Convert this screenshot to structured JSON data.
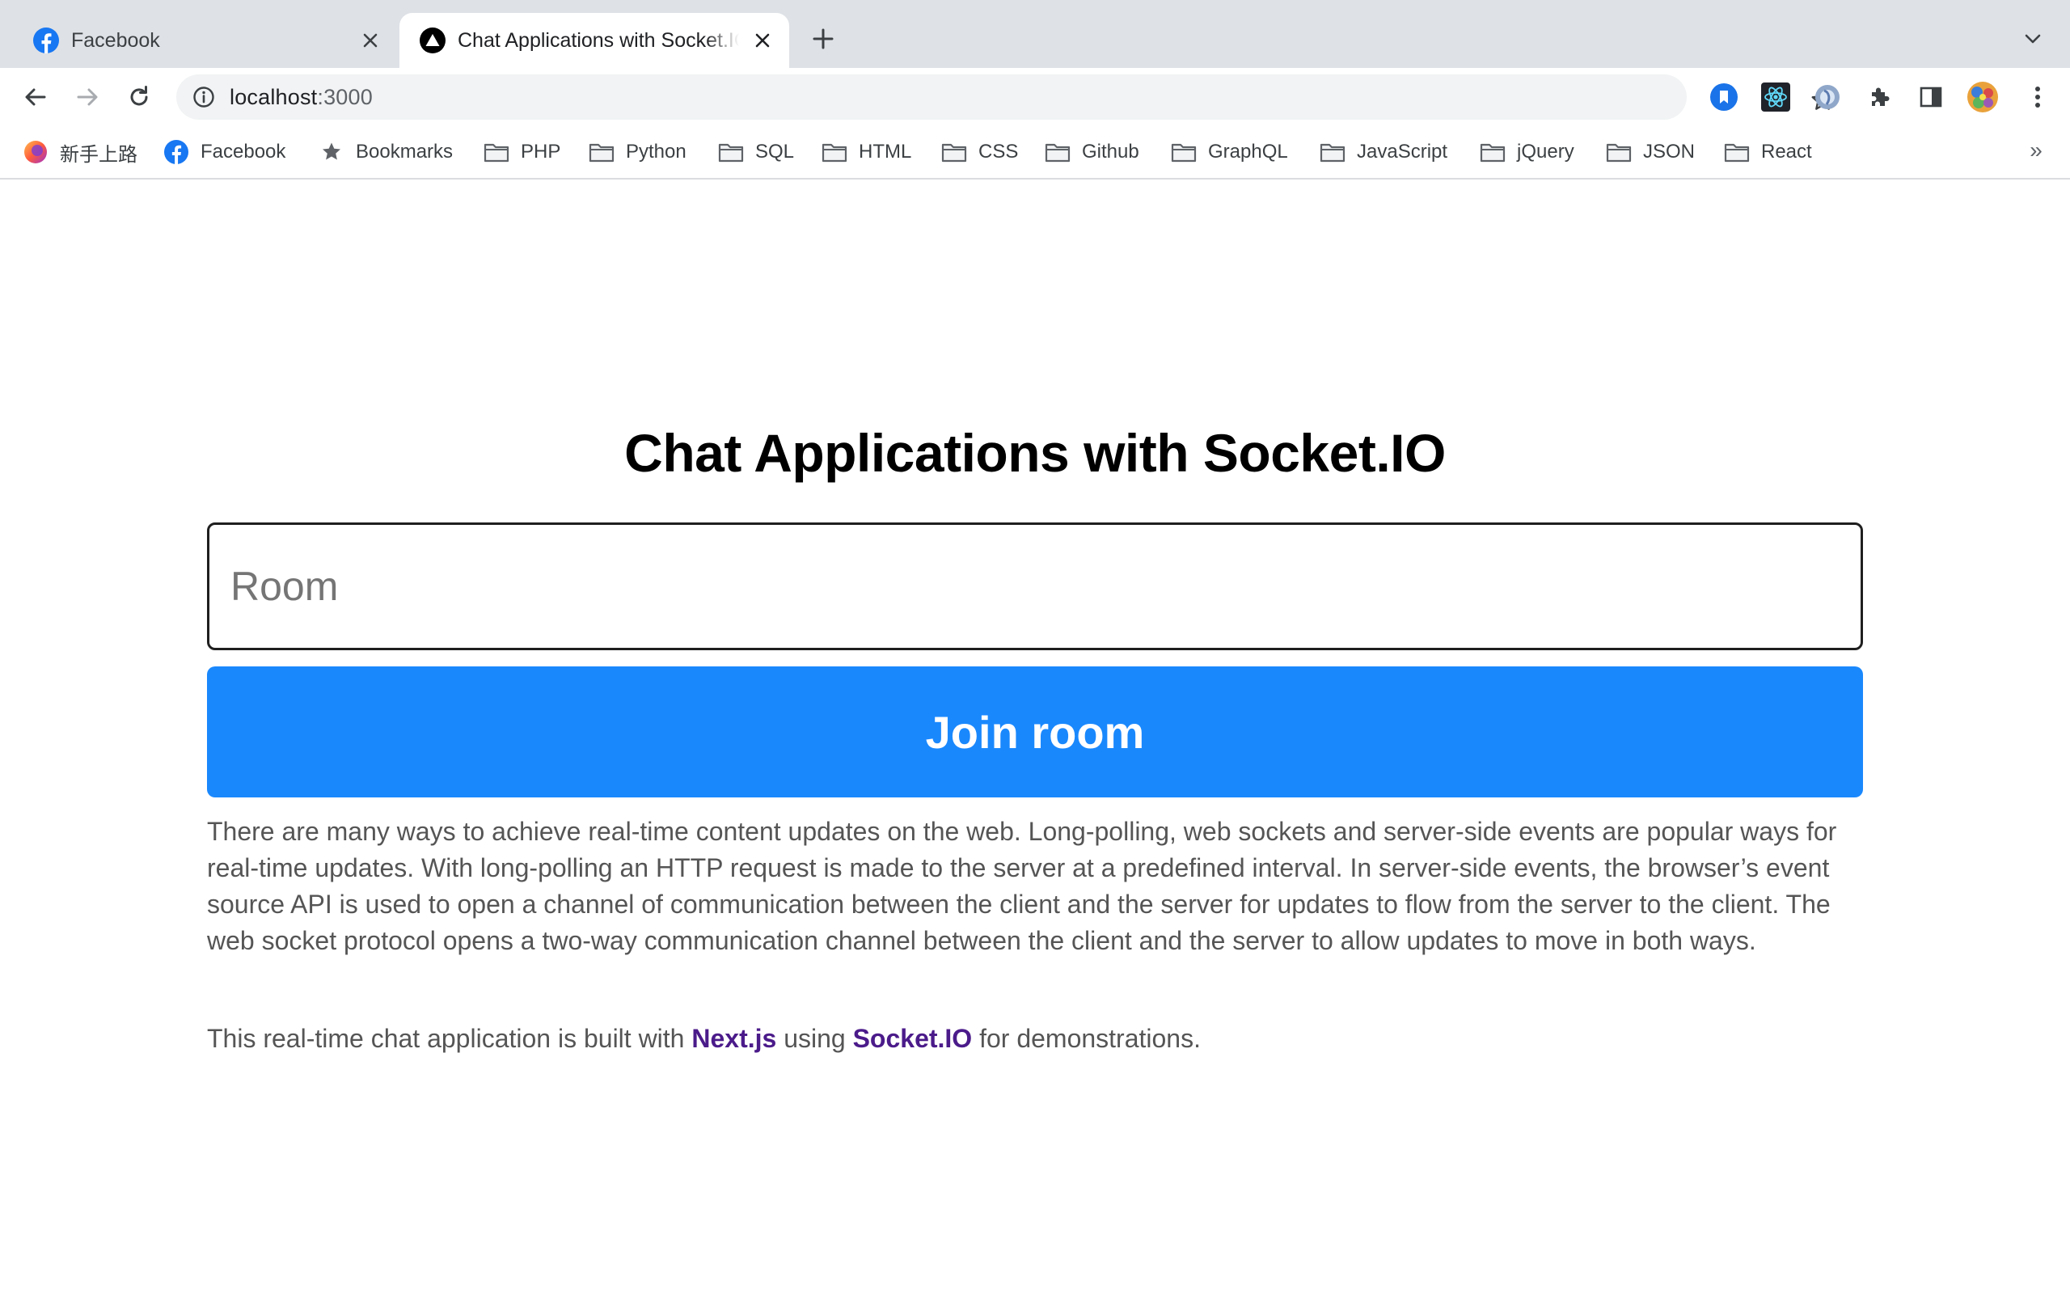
{
  "browser": {
    "tabs": [
      {
        "title": "Facebook",
        "favicon": "facebook-icon",
        "active": false
      },
      {
        "title": "Chat Applications with Socket.IO",
        "favicon": "nextjs-triangle-icon",
        "active": true
      }
    ],
    "address": {
      "host": "localhost",
      "port": ":3000"
    },
    "bookmarks": [
      {
        "label": "新手上路",
        "icon": "firefox-icon"
      },
      {
        "label": "Facebook",
        "icon": "facebook-icon"
      },
      {
        "label": "Bookmarks",
        "icon": "star-icon"
      },
      {
        "label": "PHP",
        "icon": "folder-icon"
      },
      {
        "label": "Python",
        "icon": "folder-icon"
      },
      {
        "label": "SQL",
        "icon": "folder-icon"
      },
      {
        "label": "HTML",
        "icon": "folder-icon"
      },
      {
        "label": "CSS",
        "icon": "folder-icon"
      },
      {
        "label": "Github",
        "icon": "folder-icon"
      },
      {
        "label": "GraphQL",
        "icon": "folder-icon"
      },
      {
        "label": "JavaScript",
        "icon": "folder-icon"
      },
      {
        "label": "jQuery",
        "icon": "folder-icon"
      },
      {
        "label": "JSON",
        "icon": "folder-icon"
      },
      {
        "label": "React",
        "icon": "folder-icon"
      }
    ],
    "overflow_label": "»",
    "colors": {
      "tabstrip": "#dee1e6",
      "omnibox": "#f1f3f4"
    }
  },
  "page": {
    "heading": "Chat Applications with Socket.IO",
    "room_input": {
      "value": "",
      "placeholder": "Room"
    },
    "join_button": "Join room",
    "intro": "There are many ways to achieve real-time content updates on the web. Long-polling, web sockets and server-side events are popular ways for real-time updates. With long-polling an HTTP request is made to the server at a predefined interval. In server-side events, the browser’s event source API is used to open a channel of communication between the client and the server for updates to flow from the server to the client. The web socket protocol opens a two-way communication channel between the client and the server to allow updates to move in both ways.",
    "footer": {
      "before": "This real-time chat application is built with ",
      "link1": "Next.js",
      "middle": " using ",
      "link2": "Socket.IO",
      "after": " for demonstrations."
    },
    "colors": {
      "button": "#1a88fd",
      "link": "#4b1b8a",
      "text": "#555555"
    }
  }
}
